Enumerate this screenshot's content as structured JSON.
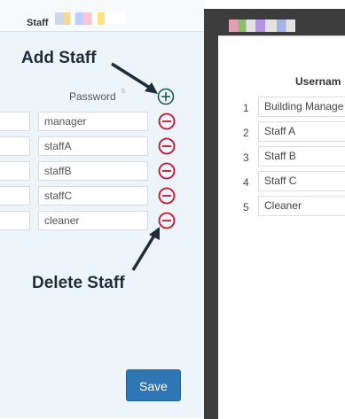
{
  "left_panel": {
    "title": "Staff",
    "password_header": "Password",
    "add_annotation": "Add Staff",
    "delete_annotation": "Delete Staff",
    "save_label": "Save",
    "passwords": [
      "manager",
      "staffA",
      "staffB",
      "staffC",
      "cleaner"
    ]
  },
  "right_panel": {
    "username_header": "Usernam",
    "rows": [
      {
        "num": "1",
        "name": "Building Manage"
      },
      {
        "num": "2",
        "name": "Staff A"
      },
      {
        "num": "3",
        "name": "Staff B"
      },
      {
        "num": "4",
        "name": "Staff C"
      },
      {
        "num": "5",
        "name": "Cleaner"
      }
    ]
  },
  "colors": {
    "accent": "#2f76b5",
    "delete_red": "#c8102e",
    "add_green": "#1f5d45",
    "dark_gap": "#3d3d3d"
  },
  "icons": {
    "add": "plus-circle-icon",
    "delete": "minus-circle-icon"
  }
}
